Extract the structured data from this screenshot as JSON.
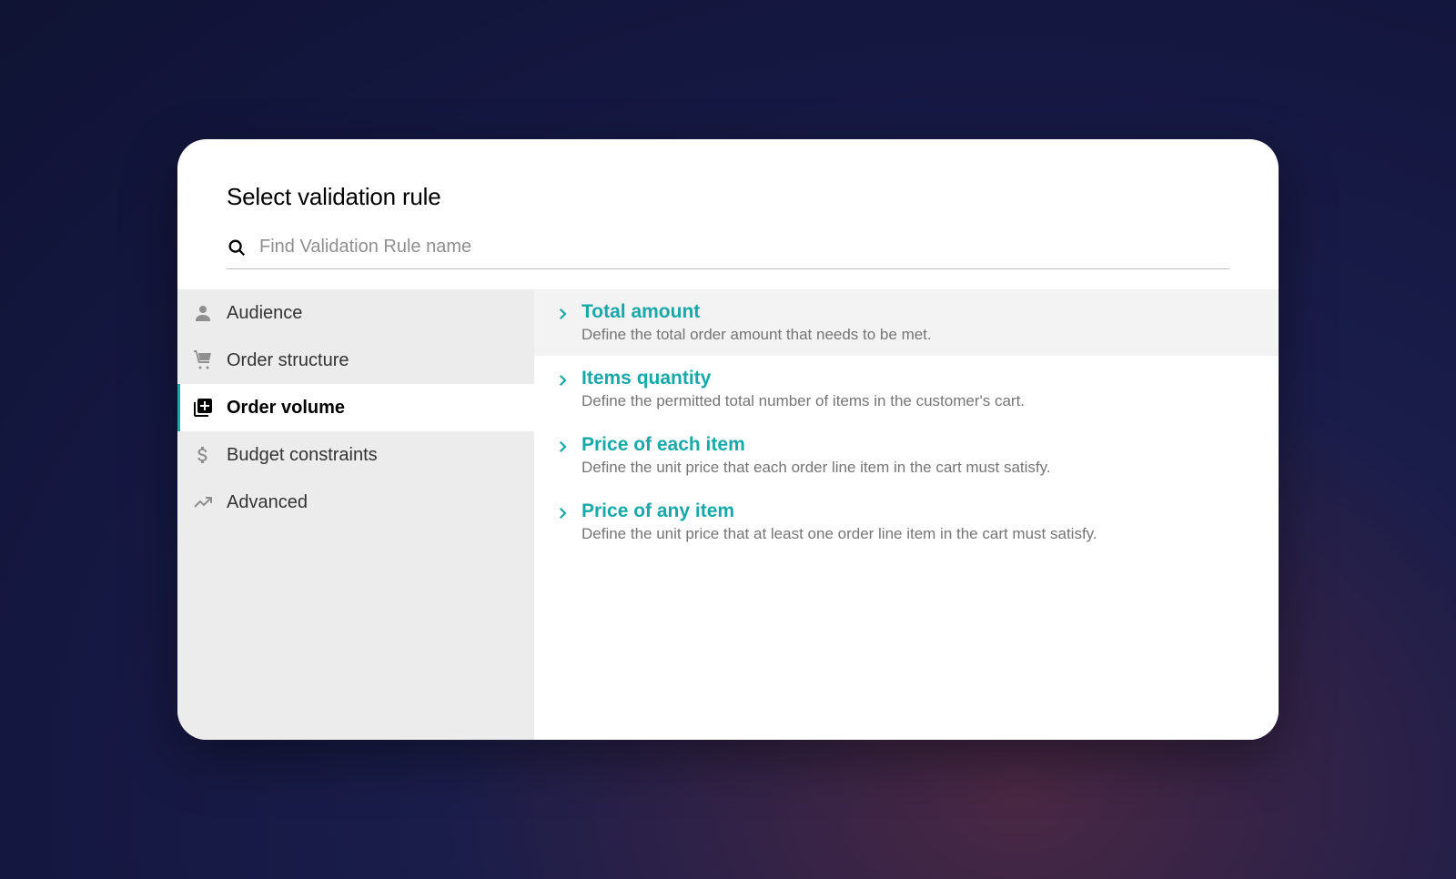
{
  "modal": {
    "title": "Select validation rule",
    "search_placeholder": "Find Validation Rule name"
  },
  "sidebar": {
    "items": [
      {
        "label": "Audience",
        "icon": "person",
        "active": false
      },
      {
        "label": "Order structure",
        "icon": "cart",
        "active": false
      },
      {
        "label": "Order volume",
        "icon": "library-add",
        "active": true
      },
      {
        "label": "Budget constraints",
        "icon": "dollar",
        "active": false
      },
      {
        "label": "Advanced",
        "icon": "trending",
        "active": false
      }
    ]
  },
  "rules": [
    {
      "title": "Total amount",
      "desc": "Define the total order amount that needs to be met.",
      "highlight": true
    },
    {
      "title": "Items quantity",
      "desc": "Define the permitted total number of items in the customer's cart.",
      "highlight": false
    },
    {
      "title": "Price of each item",
      "desc": "Define the unit price that each order line item in the cart must satisfy.",
      "highlight": false
    },
    {
      "title": "Price of any item",
      "desc": "Define the unit price that at least one order line item in the cart must satisfy.",
      "highlight": false
    }
  ]
}
